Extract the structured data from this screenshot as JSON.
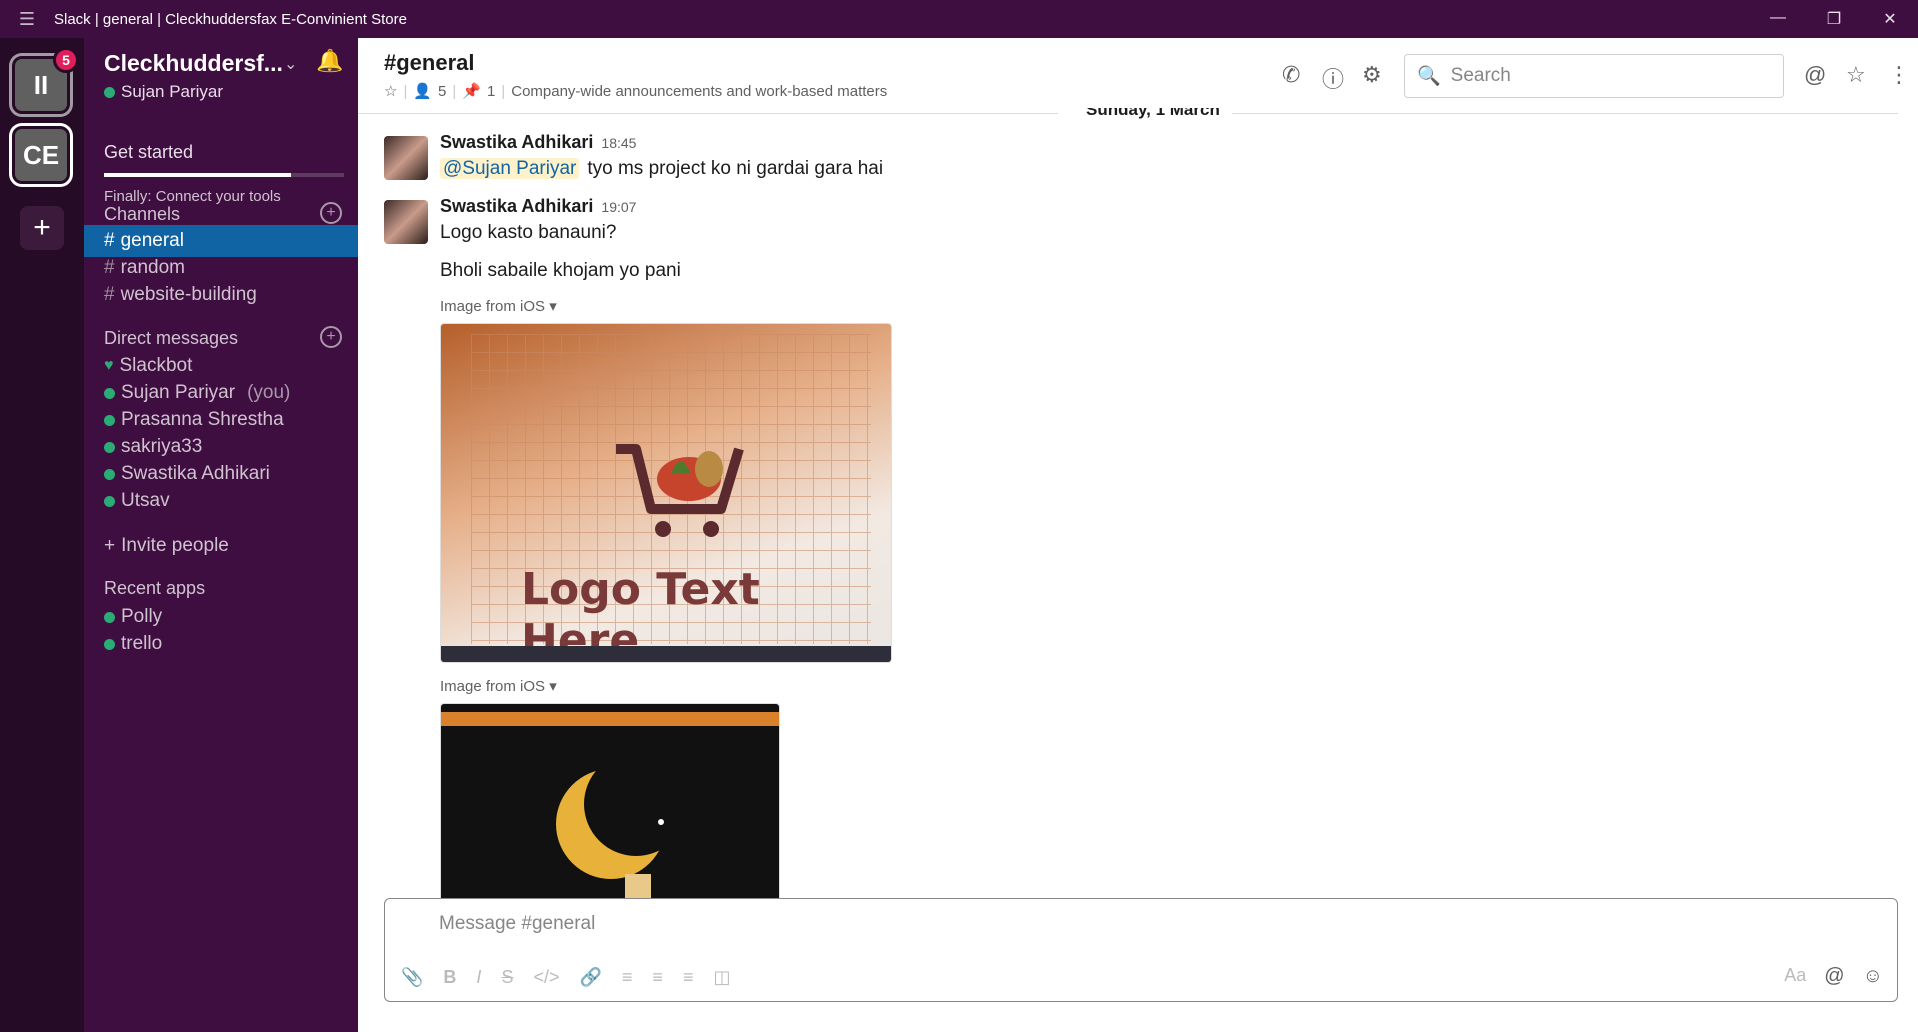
{
  "window": {
    "title": "Slack | general | Cleckhuddersfax E-Convinient Store",
    "menu_icon": "hamburger-icon",
    "controls": [
      "minimize-icon",
      "restore-icon",
      "close-icon"
    ]
  },
  "workspaces": [
    {
      "initials": "II",
      "badge": "5",
      "active": false
    },
    {
      "initials": "CE",
      "badge": null,
      "active": true
    }
  ],
  "sidebar": {
    "team_name": "Cleckhuddersf...",
    "user_name": "Sujan Pariyar",
    "get_started": "Get started",
    "progress_fraction": 0.78,
    "progress_label": "Finally: Connect your tools",
    "channels_header": "Channels",
    "channels": [
      {
        "name": "general",
        "active": true
      },
      {
        "name": "random",
        "active": false
      },
      {
        "name": "website-building",
        "active": false
      }
    ],
    "dm_header": "Direct messages",
    "dms": [
      {
        "name": "Slackbot",
        "you": ""
      },
      {
        "name": "Sujan Pariyar",
        "you": "(you)"
      },
      {
        "name": "Prasanna Shrestha",
        "you": ""
      },
      {
        "name": "sakriya33",
        "you": ""
      },
      {
        "name": "Swastika Adhikari",
        "you": ""
      },
      {
        "name": "Utsav",
        "you": ""
      }
    ],
    "invite": "Invite people",
    "apps_header": "Recent apps",
    "apps": [
      "Polly",
      "trello"
    ]
  },
  "header": {
    "channel": "#general",
    "members": "5",
    "pins": "1",
    "topic": "Company-wide announcements and work-based matters",
    "search_placeholder": "Search"
  },
  "messages": {
    "date": "Sunday, 1 March",
    "items": [
      {
        "author": "Swastika Adhikari",
        "time": "18:45",
        "mention": "@Sujan Pariyar",
        "text": "tyo ms project ko ni gardai gara hai"
      },
      {
        "author": "Swastika Adhikari",
        "time": "19:07",
        "text": "Logo kasto banauni?",
        "text2": "Bholi sabaile khojam yo pani",
        "image1_label": "Image from iOS",
        "image1_text": "Logo Text Here",
        "image2_label": "Image from iOS"
      }
    ]
  },
  "composer": {
    "placeholder": "Message #general",
    "format_label": "Aa"
  }
}
